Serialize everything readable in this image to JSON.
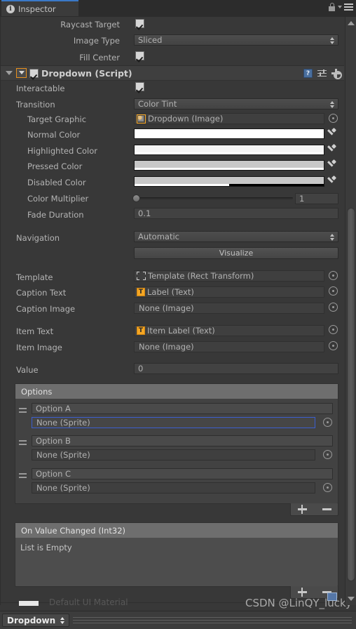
{
  "window": {
    "tab_label": "Inspector",
    "info_icon": "info-icon",
    "lock_icon": "lock-icon",
    "menu_icon": "hamburger-menu-icon"
  },
  "image_component": {
    "fields": [
      {
        "label": "Raycast Target",
        "type": "checkbox",
        "checked": true
      },
      {
        "label": "Image Type",
        "type": "popup",
        "value": "Sliced"
      },
      {
        "label": "Fill Center",
        "type": "checkbox",
        "checked": true
      }
    ]
  },
  "dropdown_component": {
    "title": "Dropdown (Script)",
    "enabled": true,
    "help_icon": "help-icon",
    "preset_icon": "preset-icon",
    "settings_icon": "gear-icon",
    "interactable": {
      "label": "Interactable",
      "checked": true
    },
    "transition": {
      "label": "Transition",
      "value": "Color Tint"
    },
    "target_graphic": {
      "label": "Target Graphic",
      "value": "Dropdown (Image)",
      "icon": "image-icon"
    },
    "colors": [
      {
        "label": "Normal Color",
        "hex": "#FFFFFF",
        "alpha_pct": 100
      },
      {
        "label": "Highlighted Color",
        "hex": "#F5F5F5",
        "alpha_pct": 100
      },
      {
        "label": "Pressed Color",
        "hex": "#C8C8C8",
        "alpha_pct": 100
      },
      {
        "label": "Disabled Color",
        "hex": "#C8C8C8",
        "alpha_pct": 50
      }
    ],
    "color_multiplier": {
      "label": "Color Multiplier",
      "value": "1",
      "slider_pct": 0
    },
    "fade_duration": {
      "label": "Fade Duration",
      "value": "0.1"
    },
    "navigation": {
      "label": "Navigation",
      "value": "Automatic"
    },
    "visualize_button": "Visualize",
    "object_fields": [
      {
        "label": "Template",
        "value": "Template (Rect Transform)",
        "icon": "rect-transform-icon"
      },
      {
        "label": "Caption Text",
        "value": "Label (Text)",
        "icon": "text-icon"
      },
      {
        "label": "Caption Image",
        "value": "None (Image)",
        "icon": "none"
      },
      {
        "label": "Item Text",
        "value": "Item Label (Text)",
        "icon": "text-icon"
      },
      {
        "label": "Item Image",
        "value": "None (Image)",
        "icon": "none"
      }
    ],
    "value_field": {
      "label": "Value",
      "value": "0"
    },
    "options": {
      "header": "Options",
      "items": [
        {
          "text": "Option A",
          "sprite": "None (Sprite)",
          "focused": true
        },
        {
          "text": "Option B",
          "sprite": "None (Sprite)",
          "focused": false
        },
        {
          "text": "Option C",
          "sprite": "None (Sprite)",
          "focused": false
        }
      ],
      "add_label": "+",
      "remove_label": "−"
    },
    "event": {
      "title": "On Value Changed (Int32)",
      "empty_text": "List is Empty",
      "add_label": "+",
      "remove_label": "−"
    }
  },
  "bottom_clipped": {
    "material_label": "Default UI Material"
  },
  "footer": {
    "object_name": "Dropdown"
  },
  "watermark": {
    "text": "CSDN @LinQY_lucky"
  },
  "scrollbar": {
    "up_icon": "scroll-up-arrow-icon",
    "down_icon": "scroll-down-arrow-icon"
  }
}
